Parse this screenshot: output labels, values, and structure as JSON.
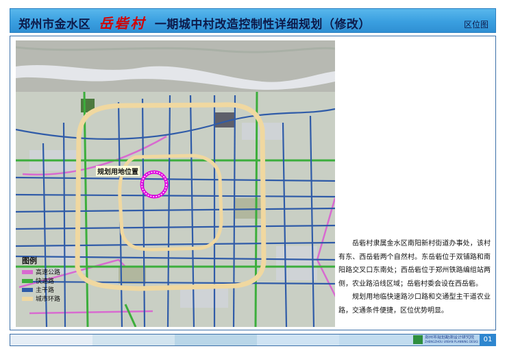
{
  "header": {
    "title_prefix": "郑州市金水区",
    "title_name": "岳砦村",
    "title_suffix": "一期城中村改造控制性详细规划（修改）",
    "section_label": "区位图"
  },
  "map": {
    "site_label": "规划用地位置",
    "legend": {
      "title": "图例",
      "items": [
        {
          "label": "高速公路",
          "color": "#d86ad0"
        },
        {
          "label": "快速路",
          "color": "#3cae3c"
        },
        {
          "label": "主干路",
          "color": "#2f5ba8"
        },
        {
          "label": "城市环路",
          "color": "#f0d8a0"
        }
      ]
    }
  },
  "description": {
    "p1": "岳砦村隶属金水区南阳新村街道办事处，该村有东、西岳砦两个自然村。东岳砦位于双铺路和南阳路交叉口东南处；西岳砦位于郑州铁路编组站两侧，农业路沿线区域；岳砦村委会设在西岳砦。",
    "p2": "规划用地临快速路沙口路和交通型主干道农业路，交通条件便捷，区位优势明显。"
  },
  "footer": {
    "org_name": "郑州市规划勘测设计研究院",
    "org_sub": "ZHENGZHOU URBAN PLANNING DESIGN & SURVEY RESEARCH INSTITUTE",
    "page_number": "01",
    "segment_colors": [
      "#e6eef6",
      "#d2e4ef",
      "#b9d6e8",
      "#cfe3f3",
      "#c2dcef",
      "#b5d4ee",
      "#d7e8f5"
    ]
  }
}
